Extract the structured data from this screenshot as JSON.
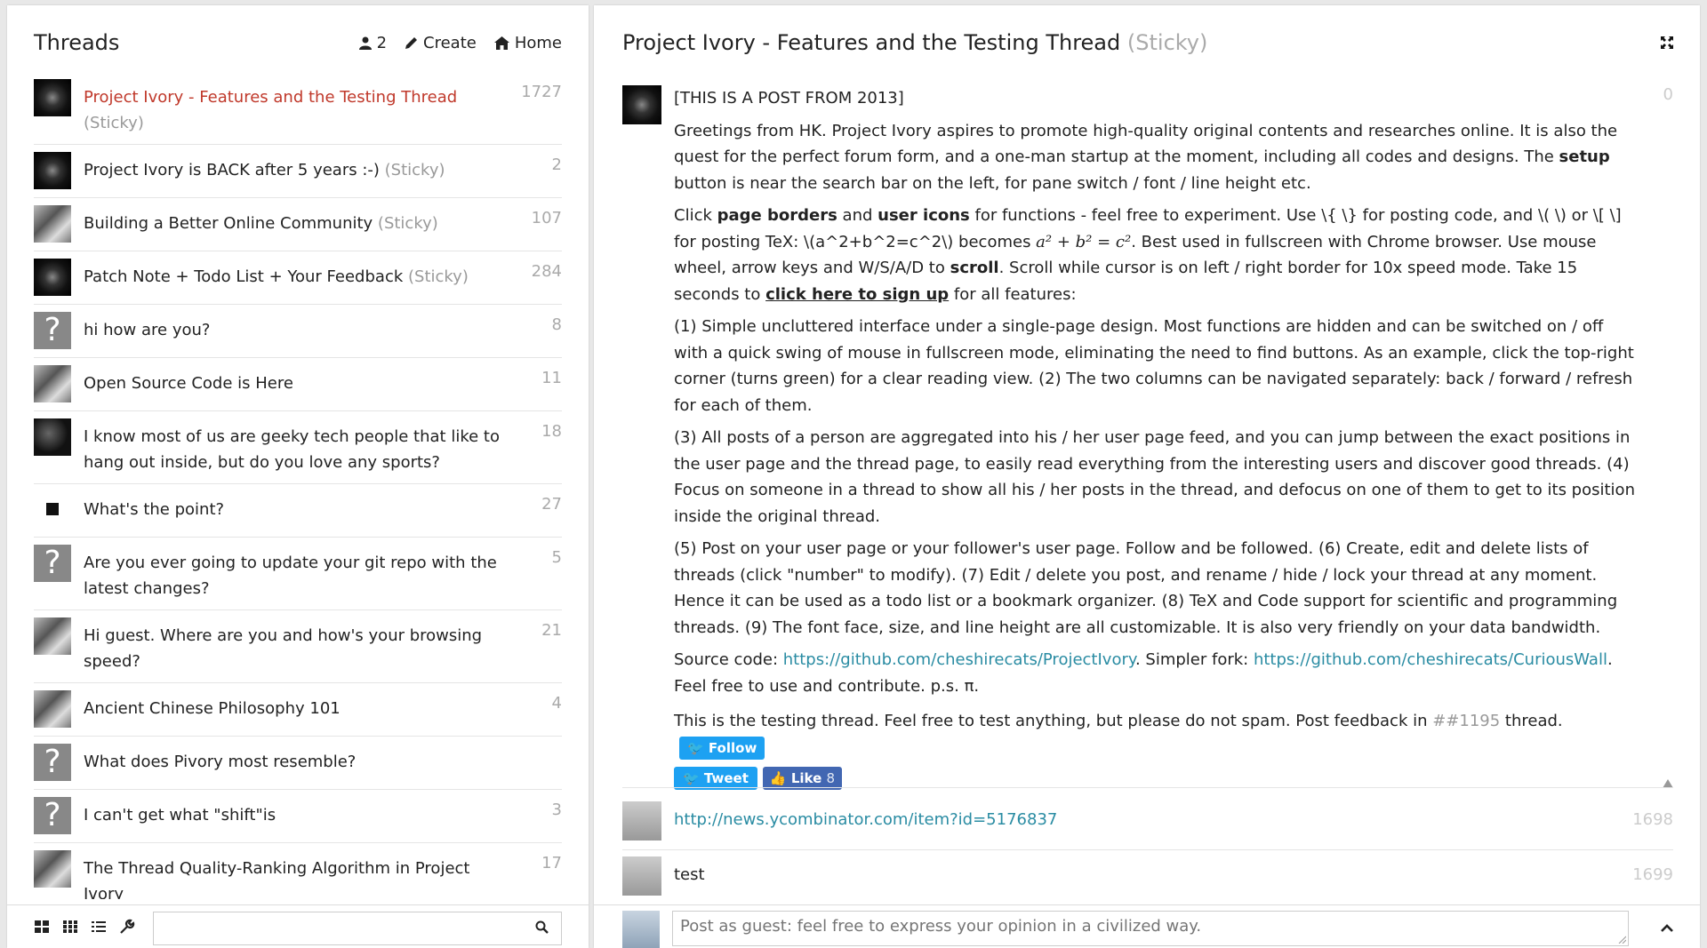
{
  "left": {
    "title": "Threads",
    "actions": {
      "users_count": "2",
      "create_label": "Create",
      "home_label": "Home"
    },
    "threads": [
      {
        "title": "Project Ivory - Features and the Testing Thread",
        "sticky": "(Sticky)",
        "count": "1727",
        "avatar": "star",
        "active": true
      },
      {
        "title": "Project Ivory is BACK after 5 years :-)",
        "sticky": "(Sticky)",
        "count": "2",
        "avatar": "star"
      },
      {
        "title": "Building a Better Online Community",
        "sticky": "(Sticky)",
        "count": "107",
        "avatar": "cat"
      },
      {
        "title": "Patch Note + Todo List + Your Feedback",
        "sticky": "(Sticky)",
        "count": "284",
        "avatar": "star"
      },
      {
        "title": "hi how are you?",
        "sticky": "",
        "count": "8",
        "avatar": "question"
      },
      {
        "title": "Open Source Code is Here",
        "sticky": "",
        "count": "11",
        "avatar": "cat"
      },
      {
        "title": "I know most of us are geeky tech people that like to hang out inside, but do you love any sports?",
        "sticky": "",
        "count": "18",
        "avatar": "dark"
      },
      {
        "title": "What's the point?",
        "sticky": "",
        "count": "27",
        "avatar": "small"
      },
      {
        "title": "Are you ever going to update your git repo with the latest changes?",
        "sticky": "",
        "count": "5",
        "avatar": "question"
      },
      {
        "title": "Hi guest. Where are you and how's your browsing speed?",
        "sticky": "",
        "count": "21",
        "avatar": "cat"
      },
      {
        "title": "Ancient Chinese Philosophy 101",
        "sticky": "",
        "count": "4",
        "avatar": "cat"
      },
      {
        "title": "What does Pivory most resemble?",
        "sticky": "",
        "count": "",
        "avatar": "question"
      },
      {
        "title": "I can't get what \"shift\"is",
        "sticky": "",
        "count": "3",
        "avatar": "question"
      },
      {
        "title": "The Thread Quality-Ranking Algorithm in Project Ivory",
        "sticky": "",
        "count": "17",
        "avatar": "cat"
      }
    ],
    "search_placeholder": ""
  },
  "right": {
    "title": "Project Ivory - Features and the Testing Thread",
    "sticky": "(Sticky)",
    "post": {
      "count": "0",
      "p0": "[THIS IS A POST FROM 2013]",
      "p1a": "Greetings from HK. Project Ivory aspires to promote high-quality original contents and researches online. It is also the quest for the perfect forum form, and a one-man startup at the moment, including all codes and designs. The ",
      "p1b": "setup",
      "p1c": " button is near the search bar on the left, for pane switch / font / line height etc.",
      "p2a": "Click ",
      "p2b": "page borders",
      "p2c": " and ",
      "p2d": "user icons",
      "p2e": " for functions - feel free to experiment. Use \\{ \\} for posting code, and \\( \\) or \\[ \\] for posting TeX: \\(a^2+b^2=c^2\\) becomes ",
      "p2tex": "a² + b² = c²",
      "p2f": ". Best used in fullscreen with Chrome browser. Use mouse wheel, arrow keys and W/S/A/D to ",
      "p2g": "scroll",
      "p2h": ". Scroll while cursor is on left / right border for 10x speed mode. Take 15 seconds to ",
      "p2link1": "click here to sign up",
      "p2i": " for all features:",
      "p3": "(1) Simple uncluttered interface under a single-page design. Most functions are hidden and can be switched on / off with a quick swing of mouse in fullscreen mode, eliminating the need to find buttons. As an example, click the top-right corner (turns green) for a clear reading view. (2) The two columns can be navigated separately: back / forward / refresh for each of them.",
      "p4": "(3) All posts of a person are aggregated into his / her user page feed, and you can jump between the exact positions in the user page and the thread page, to easily read everything from the interesting users and discover good threads. (4) Focus on someone in a thread to show all his / her posts in the thread, and defocus on one of them to get to its position inside the original thread.",
      "p5": "(5) Post on your user page or your follower's user page. Follow and be followed. (6) Create, edit and delete lists of threads (click \"number\" to modify). (7) Edit / delete you post, and rename / hide / lock your thread at any moment. Hence it can be used as a todo list or a bookmark organizer. (8) TeX and Code support for scientific and programming threads. (9) The font face, size, and line height are all customizable. It is also very friendly on your data bandwidth.",
      "p6a": "Source code: ",
      "p6link1": "https://github.com/cheshirecats/ProjectIvory",
      "p6b": ". Simpler fork: ",
      "p6link2": "https://github.com/cheshirecats/CuriousWall",
      "p6c": ". Feel free to use and contribute. p.s. π.",
      "p7a": "This is the testing thread. Feel free to test anything, but please do not spam. Post feedback in ",
      "p7ref": "##1195",
      "p7b": " thread.",
      "follow_label": "Follow",
      "tweet_label": "Tweet",
      "like_label": "Like",
      "like_count": "8"
    },
    "replies": [
      {
        "text": "http://news.ycombinator.com/item?id=5176837",
        "count": "1698",
        "link": true
      },
      {
        "text": "test",
        "count": "1699",
        "link": false
      }
    ],
    "compose_placeholder": "Post as guest: feel free to express your opinion in a civilized way."
  }
}
